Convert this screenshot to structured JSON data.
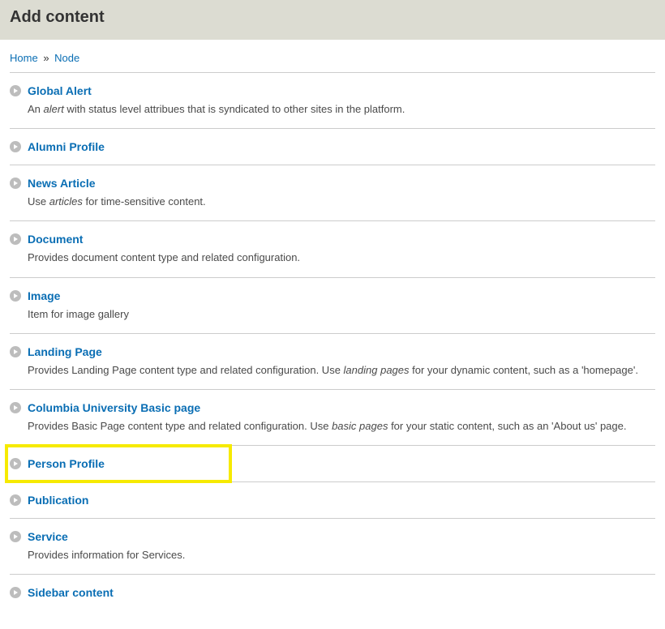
{
  "header": {
    "title": "Add content"
  },
  "breadcrumb": {
    "home": "Home",
    "sep": "»",
    "node": "Node"
  },
  "items": [
    {
      "title": "Global Alert",
      "desc_before": "An ",
      "desc_em": "alert",
      "desc_after": " with status level attribues that is syndicated to other sites in the platform.",
      "highlight": false
    },
    {
      "title": "Alumni Profile",
      "desc_before": "",
      "desc_em": "",
      "desc_after": "",
      "highlight": false
    },
    {
      "title": "News Article",
      "desc_before": "Use ",
      "desc_em": "articles",
      "desc_after": " for time-sensitive content.",
      "highlight": false
    },
    {
      "title": "Document",
      "desc_before": "Provides document content type and related configuration.",
      "desc_em": "",
      "desc_after": "",
      "highlight": false
    },
    {
      "title": "Image",
      "desc_before": "Item for image gallery",
      "desc_em": "",
      "desc_after": "",
      "highlight": false
    },
    {
      "title": "Landing Page",
      "desc_before": "Provides Landing Page content type and related configuration. Use ",
      "desc_em": "landing pages",
      "desc_after": " for your dynamic content, such as a 'homepage'.",
      "highlight": false
    },
    {
      "title": "Columbia University Basic page",
      "desc_before": "Provides Basic Page content type and related configuration. Use ",
      "desc_em": "basic pages",
      "desc_after": " for your static content, such as an 'About us' page.",
      "highlight": false
    },
    {
      "title": "Person Profile",
      "desc_before": "",
      "desc_em": "",
      "desc_after": "",
      "highlight": true
    },
    {
      "title": "Publication",
      "desc_before": "",
      "desc_em": "",
      "desc_after": "",
      "highlight": false
    },
    {
      "title": "Service",
      "desc_before": "Provides information for Services.",
      "desc_em": "",
      "desc_after": "",
      "highlight": false
    },
    {
      "title": "Sidebar content",
      "desc_before": "",
      "desc_em": "",
      "desc_after": "",
      "highlight": false,
      "last": true
    }
  ]
}
